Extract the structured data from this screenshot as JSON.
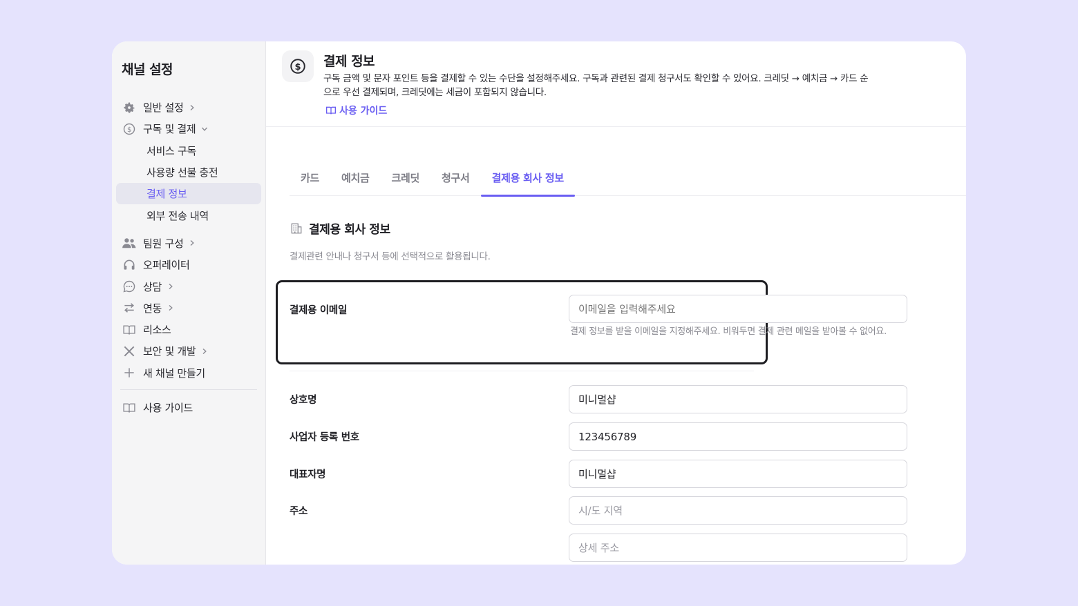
{
  "sidebar": {
    "title": "채널 설정",
    "items": [
      {
        "label": "일반 설정",
        "icon": "gear-icon",
        "chevron": "right"
      },
      {
        "label": "구독 및 결제",
        "icon": "dollar-icon",
        "chevron": "down"
      },
      {
        "label": "팀원 구성",
        "icon": "people-icon",
        "chevron": "right"
      },
      {
        "label": "오퍼레이터",
        "icon": "headset-icon"
      },
      {
        "label": "상담",
        "icon": "chat-icon",
        "chevron": "right"
      },
      {
        "label": "연동",
        "icon": "arrows-icon",
        "chevron": "right"
      },
      {
        "label": "리소스",
        "icon": "book-icon"
      },
      {
        "label": "보안 및 개발",
        "icon": "tools-icon",
        "chevron": "right"
      },
      {
        "label": "새 채널 만들기",
        "icon": "plus-icon"
      }
    ],
    "subitems": [
      "서비스 구독",
      "사용량 선불 충전",
      "결제 정보",
      "외부 전송 내역"
    ],
    "active_subitem": "결제 정보",
    "guide": "사용 가이드"
  },
  "header": {
    "title": "결제 정보",
    "description": "구독 금액 및 문자 포인트 등을 결제할 수 있는 수단을 설정해주세요. 구독과 관련된 결제 청구서도 확인할 수 있어요. 크레딧 → 예치금 → 카드 순으로 우선 결제되며, 크레딧에는 세금이 포함되지 않습니다.",
    "guide_link": "사용 가이드"
  },
  "tabs": [
    "카드",
    "예치금",
    "크레딧",
    "청구서",
    "결제용 회사 정보"
  ],
  "active_tab": "결제용 회사 정보",
  "section": {
    "title": "결제용 회사 정보",
    "description": "결제관련 안내나 청구서 등에 선택적으로 활용됩니다."
  },
  "form": {
    "email": {
      "label": "결제용 이메일",
      "value": "",
      "placeholder": "이메일을 입력해주세요",
      "help": "결제 정보를 받을 이메일을 지정해주세요. 비워두면 결제 관련 메일을 받아볼 수 없어요."
    },
    "company": {
      "label": "상호명",
      "value": "미니멀샵"
    },
    "business_number": {
      "label": "사업자 등록 번호",
      "value": "123456789"
    },
    "representative": {
      "label": "대표자명",
      "value": "미니멀샵"
    },
    "address": {
      "label": "주소",
      "region_placeholder": "시/도 지역",
      "detail_placeholder": "상세 주소"
    }
  },
  "colors": {
    "accent": "#6a5ef2",
    "background": "#e5e3fd"
  }
}
